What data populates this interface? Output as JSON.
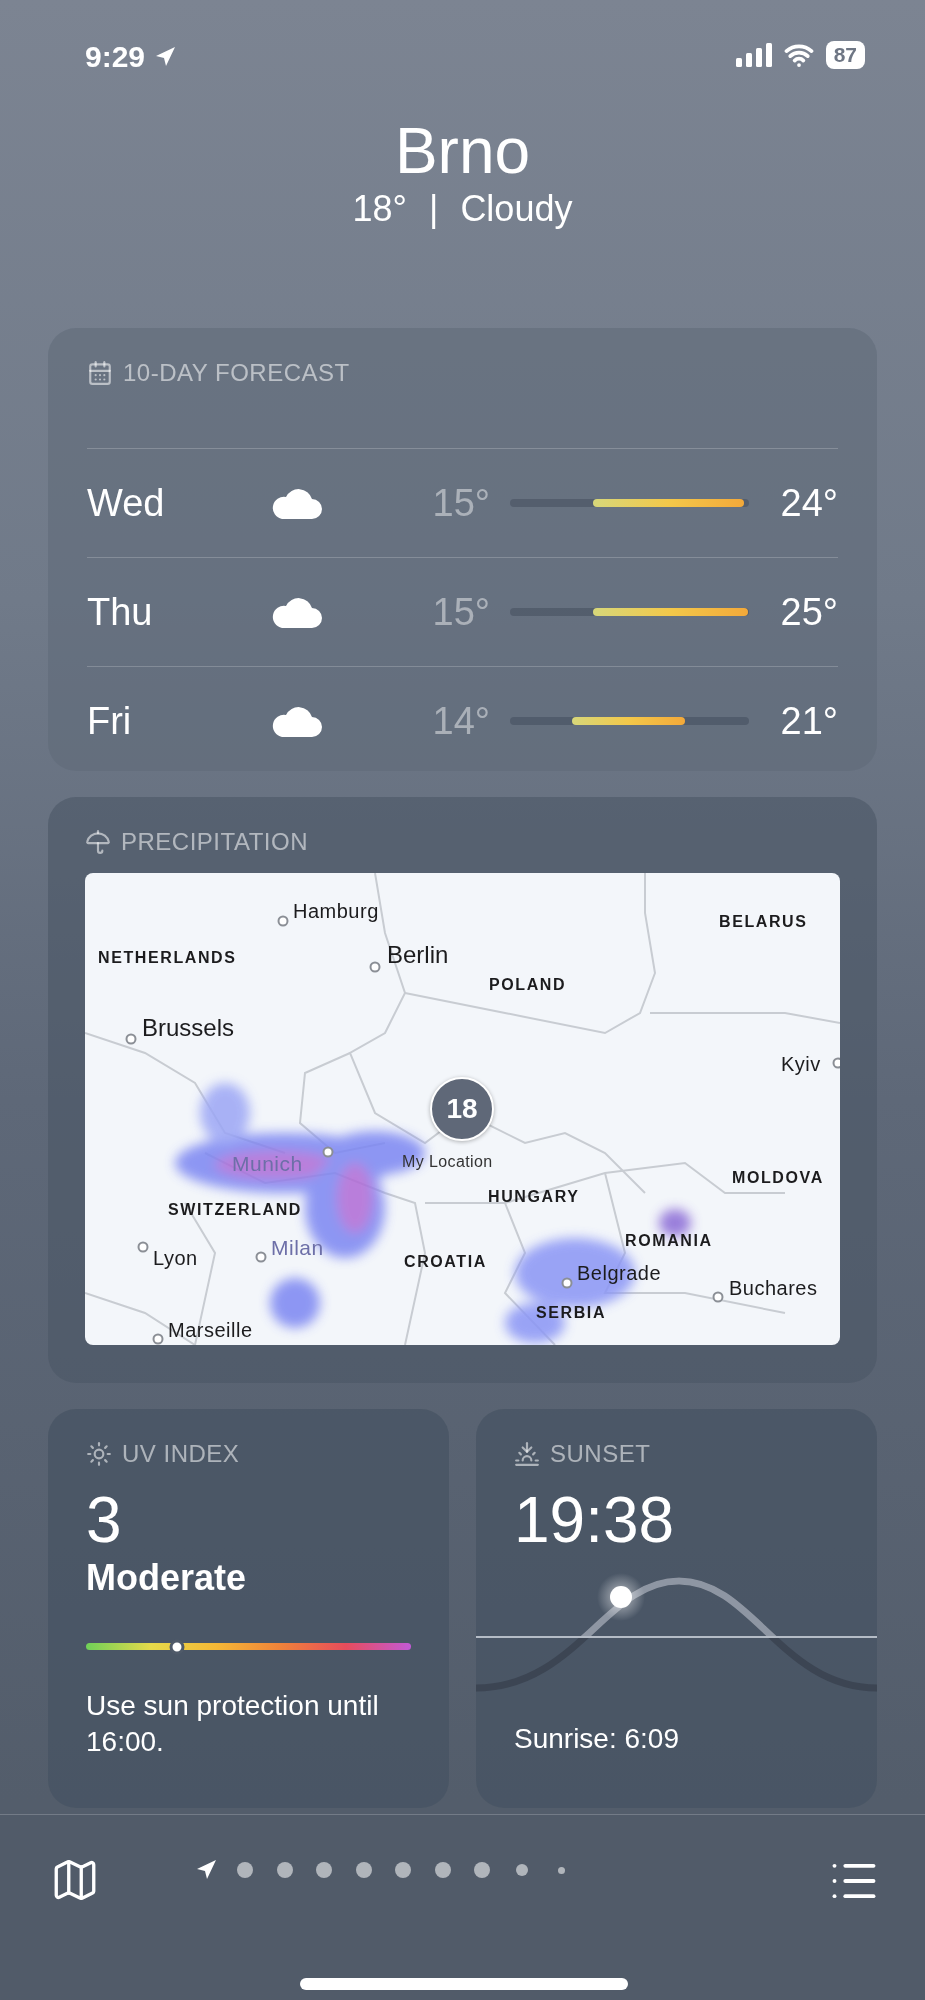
{
  "status_bar": {
    "time": "9:29",
    "battery": "87"
  },
  "header": {
    "city": "Brno",
    "temperature": "18°",
    "separator": "|",
    "condition": "Cloudy"
  },
  "forecast": {
    "title": "10-DAY FORECAST",
    "days": [
      {
        "day": "Wed",
        "low": "15°",
        "high": "24°",
        "level": 0.63
      },
      {
        "day": "Thu",
        "low": "15°",
        "high": "25°",
        "level": 0.65
      },
      {
        "day": "Fri",
        "low": "14°",
        "high": "21°",
        "level": 0.47
      }
    ]
  },
  "precipitation": {
    "title": "PRECIPITATION",
    "map": {
      "badge": "18",
      "labels": [
        {
          "text": "Hamburg",
          "kind": "city"
        },
        {
          "text": "NETHERLANDS",
          "kind": "country"
        },
        {
          "text": "Berlin",
          "kind": "capital"
        },
        {
          "text": "POLAND",
          "kind": "country"
        },
        {
          "text": "BELARUS",
          "kind": "country"
        },
        {
          "text": "Brussels",
          "kind": "capital"
        },
        {
          "text": "Kyiv",
          "kind": "city"
        },
        {
          "text": "Munich",
          "kind": "faded"
        },
        {
          "text": "My Location",
          "kind": "location"
        },
        {
          "text": "SWITZERLAND",
          "kind": "country"
        },
        {
          "text": "HUNGARY",
          "kind": "country"
        },
        {
          "text": "MOLDOVA",
          "kind": "country"
        },
        {
          "text": "ROMANIA",
          "kind": "country"
        },
        {
          "text": "Lyon",
          "kind": "city"
        },
        {
          "text": "Milan",
          "kind": "faded"
        },
        {
          "text": "CROATIA",
          "kind": "country"
        },
        {
          "text": "Belgrade",
          "kind": "city"
        },
        {
          "text": "Buchares",
          "kind": "city"
        },
        {
          "text": "SERBIA",
          "kind": "country"
        },
        {
          "text": "Marseille",
          "kind": "city"
        }
      ]
    }
  },
  "uv": {
    "title": "UV INDEX",
    "value": "3",
    "category": "Moderate",
    "level": 0.28,
    "advice": "Use sun protection until 16:00."
  },
  "sunset": {
    "title": "SUNSET",
    "time": "19:38",
    "sunrise": "Sunrise: 6:09"
  },
  "pages": [
    {
      "kind": "location",
      "selected": true
    },
    {
      "kind": "dot",
      "selected": false
    },
    {
      "kind": "dot",
      "selected": false
    },
    {
      "kind": "dot",
      "selected": false
    },
    {
      "kind": "dot",
      "selected": false
    },
    {
      "kind": "dot",
      "selected": false
    },
    {
      "kind": "dot",
      "selected": false
    },
    {
      "kind": "dot",
      "selected": false
    },
    {
      "kind": "small",
      "selected": false
    },
    {
      "kind": "tiny",
      "selected": false
    }
  ]
}
